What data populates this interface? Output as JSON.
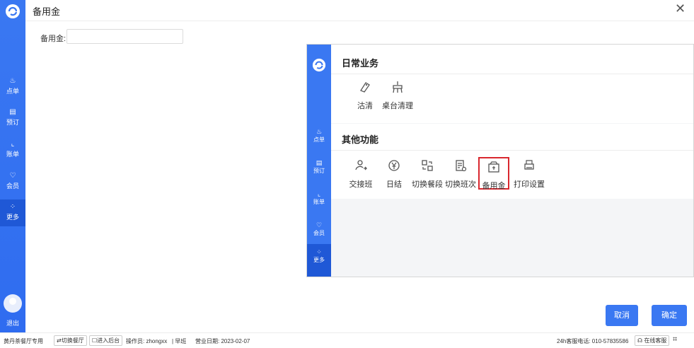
{
  "header": {
    "title": "备用金"
  },
  "form": {
    "label": "备用金:",
    "value": ""
  },
  "left_rail": {
    "items": [
      {
        "label": "点单",
        "icon": "dish-icon"
      },
      {
        "label": "预订",
        "icon": "calendar-icon"
      },
      {
        "label": "账单",
        "icon": "chart-icon"
      },
      {
        "label": "会员",
        "icon": "member-icon"
      },
      {
        "label": "更多",
        "icon": "grid-icon"
      }
    ],
    "active": "更多",
    "exit_label": "退出"
  },
  "embedded": {
    "rail_items": [
      "点单",
      "预订",
      "账单",
      "会员",
      "更多"
    ],
    "sections": [
      {
        "title": "日常业务",
        "items": [
          "沽清",
          "桌台清理"
        ]
      },
      {
        "title": "其他功能",
        "items": [
          "交接班",
          "日结",
          "切换餐段",
          "切换班次",
          "备用金",
          "打印设置"
        ]
      }
    ],
    "highlighted": "备用金"
  },
  "buttons": {
    "cancel": "取消",
    "confirm": "确定"
  },
  "status_bar": {
    "store": "黄丹茶餐厅专用",
    "switch": "⇄切换餐厅",
    "backend": "☐进入后台",
    "operator": "操作员: zhongxx",
    "shift": "| 早班",
    "business_date": "营业日期: 2023-02-07",
    "hotline": "24h客服电话: 010-57835586",
    "online": "在线客服"
  },
  "colors": {
    "brand": "#3a78f2",
    "highlight": "#d9272e"
  }
}
